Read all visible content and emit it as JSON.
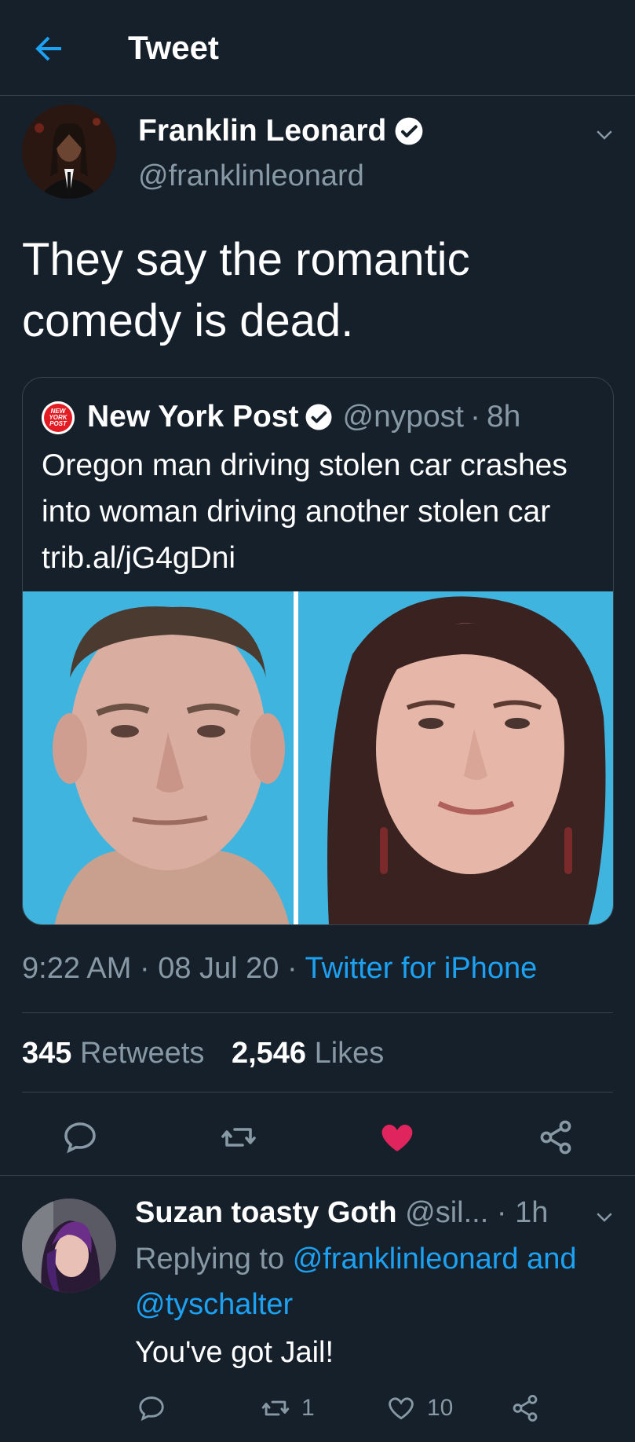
{
  "header": {
    "title": "Tweet",
    "back_icon": "arrow-left-icon",
    "accent": "#1da1f2"
  },
  "tweet": {
    "author_name": "Franklin Leonard",
    "author_handle": "@franklinleonard",
    "verified": true,
    "text": "They say the romantic comedy is dead.",
    "timestamp_time": "9:22 AM",
    "timestamp_date": "08 Jul 20",
    "source": "Twitter for iPhone",
    "retweets_count": "345",
    "retweets_label": "Retweets",
    "likes_count": "2,546",
    "likes_label": "Likes",
    "liked": true,
    "like_color": "#e0245e"
  },
  "quote": {
    "author_name": "New York Post",
    "handle": "@nypost",
    "time": "8h",
    "text": "Oregon man driving stolen car crashes into woman driving another stolen car trib.al/jG4gDni",
    "logo_text": "NEW YORK POST"
  },
  "reply": {
    "author_name": "Suzan toasty Goth",
    "handle": "@sil...",
    "time": "1h",
    "replying_prefix": "Replying to",
    "replying_user1": "@franklinleonard",
    "replying_and": "and",
    "replying_user2": "@tyschalter",
    "text": "You've got Jail!",
    "retweet_count": "1",
    "like_count": "10"
  }
}
